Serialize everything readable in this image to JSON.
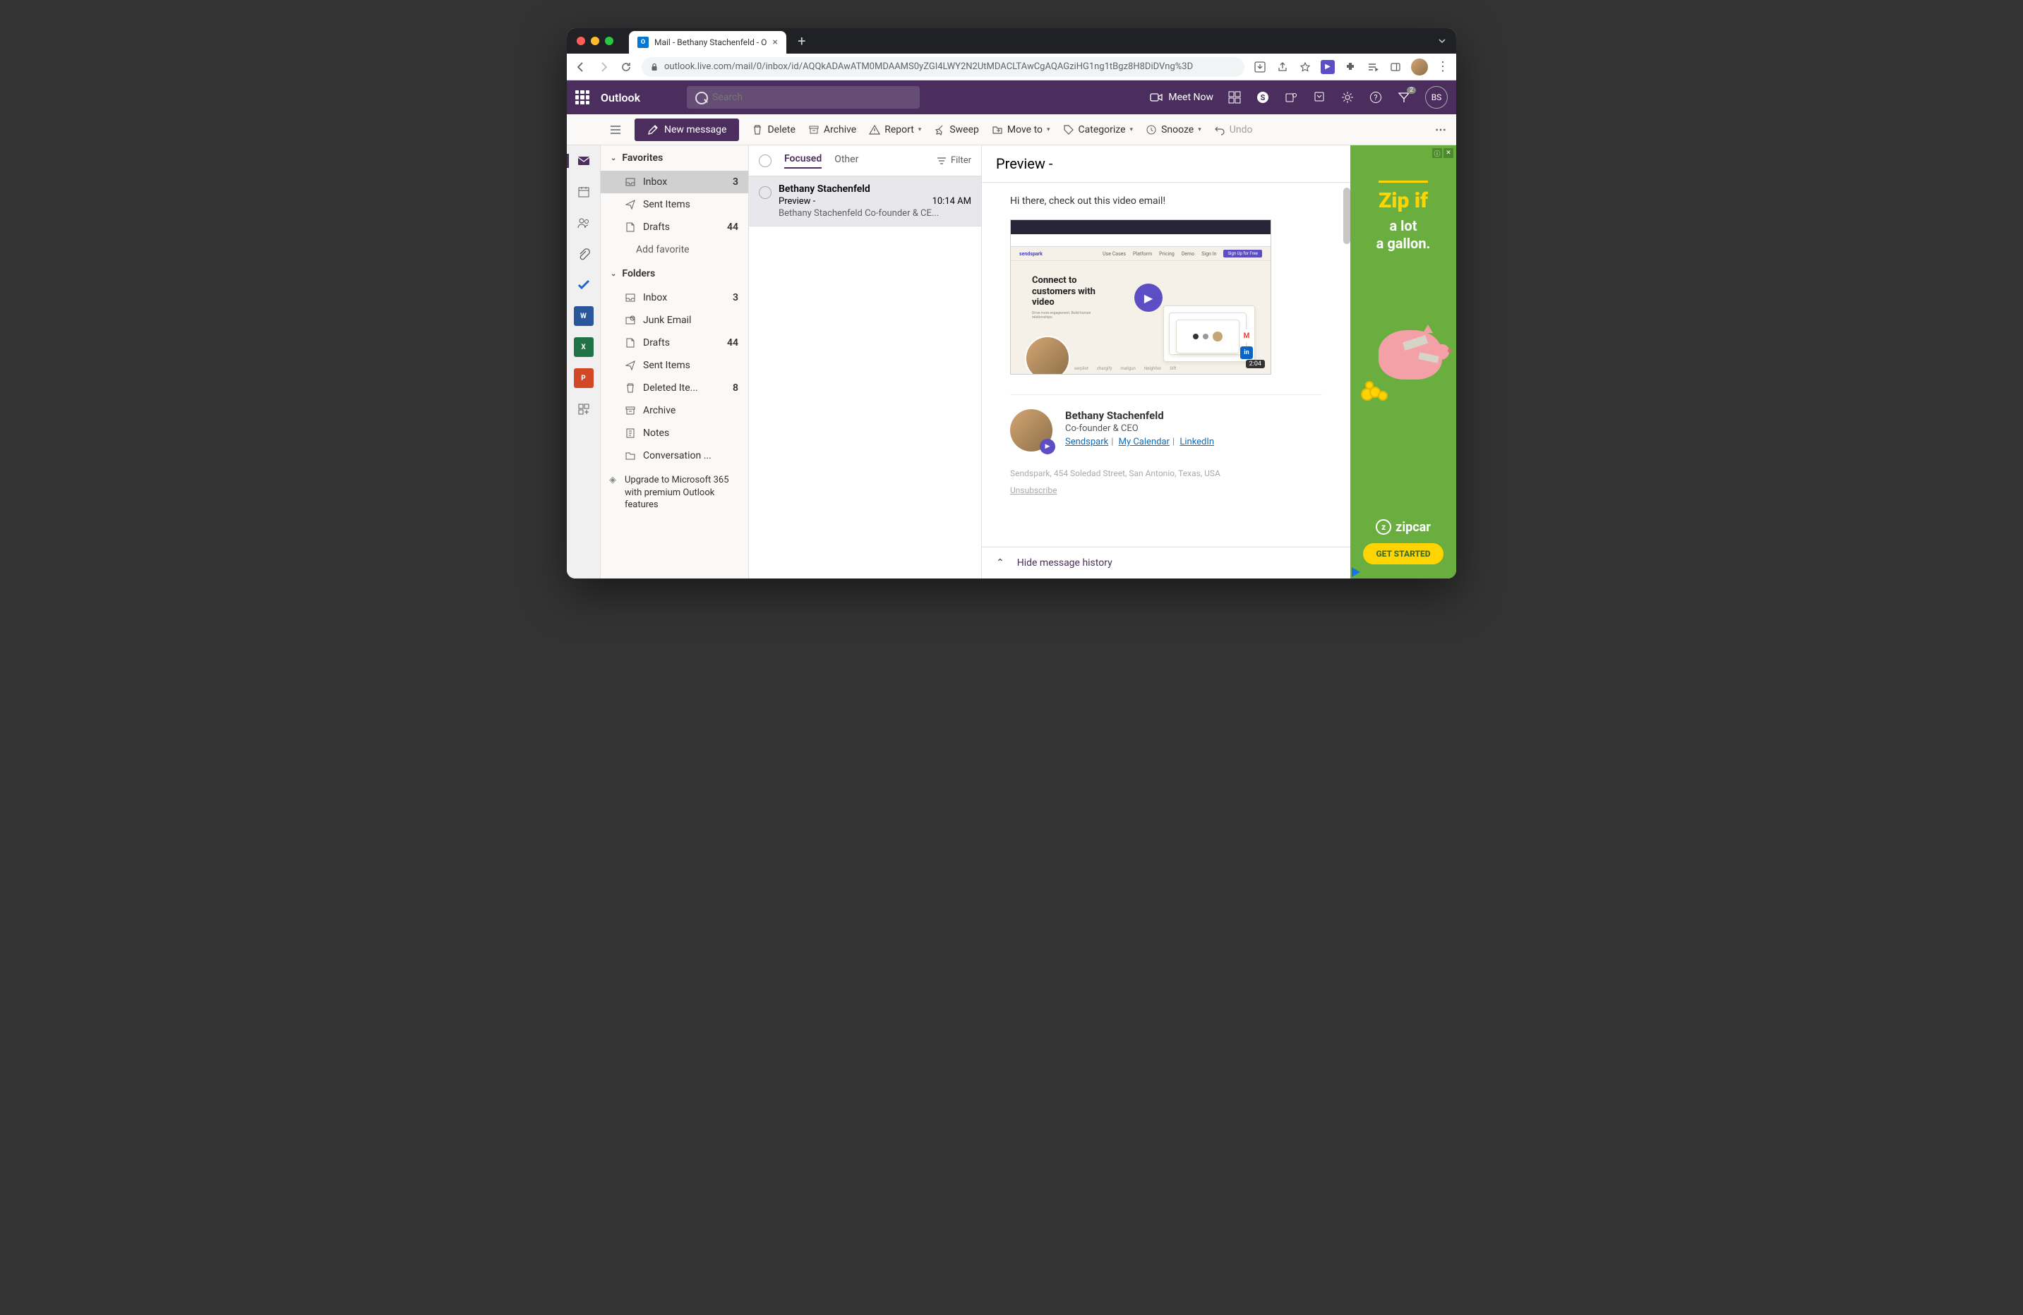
{
  "browser": {
    "tab_title": "Mail - Bethany Stachenfeld - O",
    "url": "outlook.live.com/mail/0/inbox/id/AQQkADAwATM0MDAAMS0yZGI4LWY2N2UtMDACLTAwCgAQAGziHG1ng1tBgz8H8DiDVng%3D"
  },
  "suite": {
    "brand": "Outlook",
    "search_placeholder": "Search",
    "meet_now": "Meet Now",
    "initials": "BS",
    "notif_count": "2"
  },
  "cmdbar": {
    "new_message": "New message",
    "delete": "Delete",
    "archive": "Archive",
    "report": "Report",
    "sweep": "Sweep",
    "move_to": "Move to",
    "categorize": "Categorize",
    "snooze": "Snooze",
    "undo": "Undo"
  },
  "nav": {
    "favorites": "Favorites",
    "folders": "Folders",
    "add_favorite": "Add favorite",
    "fav_items": [
      {
        "label": "Inbox",
        "count": "3"
      },
      {
        "label": "Sent Items",
        "count": ""
      },
      {
        "label": "Drafts",
        "count": "44"
      }
    ],
    "folder_items": [
      {
        "label": "Inbox",
        "count": "3"
      },
      {
        "label": "Junk Email",
        "count": ""
      },
      {
        "label": "Drafts",
        "count": "44"
      },
      {
        "label": "Sent Items",
        "count": ""
      },
      {
        "label": "Deleted Ite...",
        "count": "8"
      },
      {
        "label": "Archive",
        "count": ""
      },
      {
        "label": "Notes",
        "count": ""
      },
      {
        "label": "Conversation ...",
        "count": ""
      }
    ],
    "upgrade": "Upgrade to Microsoft 365 with premium Outlook features"
  },
  "list": {
    "focused": "Focused",
    "other": "Other",
    "filter": "Filter",
    "msg": {
      "from": "Bethany Stachenfeld",
      "subject": "Preview -",
      "time": "10:14 AM",
      "preview": "Bethany Stachenfeld Co-founder & CE..."
    }
  },
  "reading": {
    "subject": "Preview -",
    "greeting": "Hi there, check out this video email!",
    "video": {
      "headline": "Connect to customers with video",
      "sub": "Drive more engagement. Build human relationships.",
      "logo": "sendspark",
      "nav": [
        "Use Cases",
        "Platform",
        "Pricing",
        "Demo",
        "Sign In"
      ],
      "signup": "Sign Up for Free",
      "duration": "2:04",
      "brands": [
        "serpilot",
        "chargify",
        "mailgun",
        "Neighbor",
        "Sift"
      ]
    },
    "sig": {
      "name": "Bethany Stachenfeld",
      "title": "Co-founder & CEO",
      "links": [
        "Sendspark",
        "My Calendar",
        "LinkedIn"
      ]
    },
    "address": "Sendspark, 454 Soledad Street, San Antonio, Texas, USA",
    "unsubscribe": "Unsubscribe",
    "hide_history": "Hide message history"
  },
  "ad": {
    "headline": "Zip if",
    "sub1": "a lot",
    "sub2": "a gallon.",
    "brand": "zipcar",
    "cta": "GET STARTED"
  }
}
